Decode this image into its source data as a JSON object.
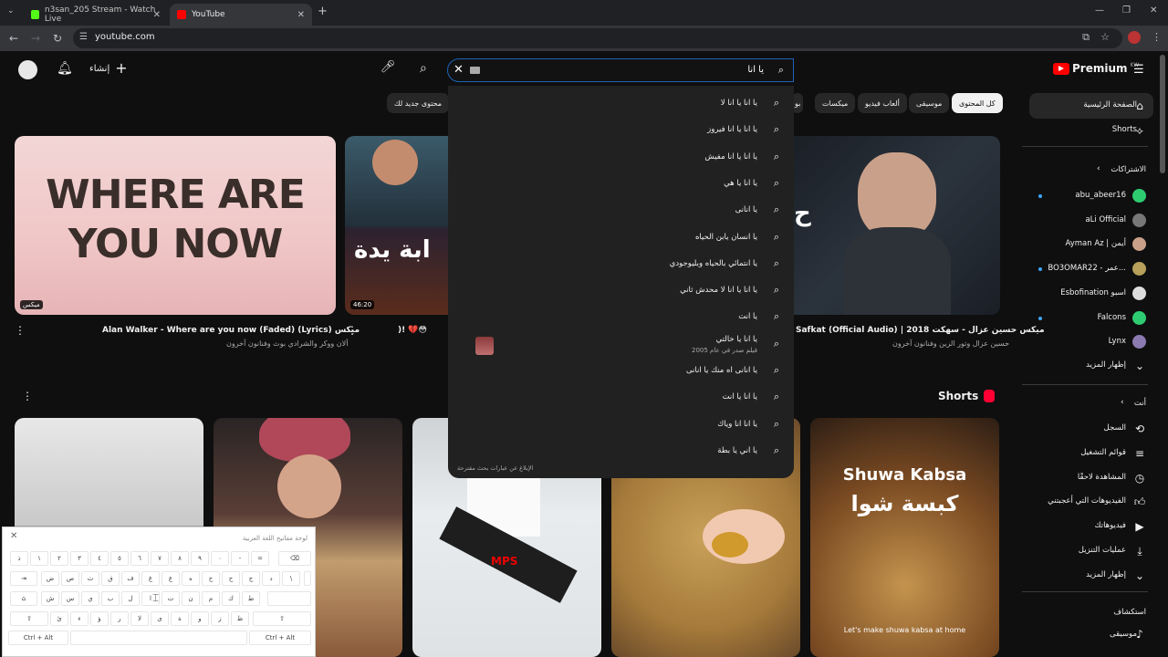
{
  "browser": {
    "tabs": [
      {
        "label": "n3san_205 Stream - Watch Live",
        "active": false
      },
      {
        "label": "YouTube",
        "active": true
      }
    ],
    "url": "youtube.com"
  },
  "header": {
    "create_label": "إنشاء",
    "search_query": "يا انا",
    "logo_text": "Premium",
    "logo_country": "KW"
  },
  "search_suggestions": [
    "يا انا يا انا لا",
    "يا انا يا انا فيروز",
    "يا انا يا انا مفيش",
    "يا انا يا هي",
    "يا انانى",
    "يا انسان يابن الحياه",
    "يا انتمائي بالحياه وبليوجودي",
    "يا انا يا انا لا محدش ثاني",
    "يا انت",
    "يا انا يا خالتي",
    "يا انانى اه منك يا انانى",
    "يا انا يا انت",
    "يا انا انا وياك",
    "يا اني يا بطة"
  ],
  "suggestion_movie_sub": "فيلم صدر في عام 2005",
  "suggest_report": "الإبلاغ عن عبارات بحث مقترحة",
  "chips": [
    "كل المحتوى",
    "موسيقى",
    "ألعاب فيديو",
    "ميكسات",
    "محتوى جديد لك"
  ],
  "chip_partial": "بو",
  "sidebar": {
    "home": "الصفحة الرئيسية",
    "shorts": "Shorts",
    "subs_title": "الاشتراكات",
    "subs": [
      "abu_abeer16",
      "aLi Official",
      "Ayman Az | أيمن",
      "BO3OMAR22 - عمر...",
      "Esbofination اسبو",
      "Falcons",
      "Lynx"
    ],
    "show_more": "إظهار المزيد",
    "you_title": "أنت",
    "you_items": [
      "السجل",
      "قوائم التشغيل",
      "المشاهدة لاحقًا",
      "الفيديوهات التي أعجبتني",
      "فيديوهاتك",
      "عمليات التنزيل",
      "إظهار المزيد"
    ],
    "explore_title": "استكشاف",
    "explore_items": [
      "موسيقى"
    ]
  },
  "videos": {
    "v1_title": "ميكس Alan Walker - Where are you now (Faded) (Lyrics)",
    "v1_sub": "ألان ووكر والشرادي بوث وفنانون آخرون",
    "v1_thumb_text": "WHERE ARE YOU NOW",
    "v1_badge": "ميكس",
    "v2_time": "46:20",
    "v2_title": "😳💔 !(",
    "v2_thumb_text": "ابة يدة",
    "v3_title": "ميكس حسين عزال - سهكت 2018 | Safkat (Official Audio)",
    "v3_sub": "حسين عزال وتور الزين وفنانون آخرون",
    "shorts_title": "Shorts",
    "short5_text1": "Shuwa Kabsa",
    "short5_text2": "كبسة شوا",
    "short5_caption": "Let's make shuwa kabsa at home"
  },
  "keyboard": {
    "title": "لوحة مفاتيح اللغة العربية",
    "row1": [
      "ذ",
      "١",
      "٢",
      "٣",
      "٤",
      "٥",
      "٦",
      "٧",
      "٨",
      "٩",
      "٠",
      "-",
      "="
    ],
    "row2": [
      "ض",
      "ص",
      "ث",
      "ق",
      "ف",
      "غ",
      "ع",
      "ه",
      "خ",
      "ح",
      "ج",
      "د",
      "\\"
    ],
    "row3": [
      "ش",
      "س",
      "ي",
      "ب",
      "ل",
      "ا",
      "ت",
      "ن",
      "م",
      "ك",
      "ط"
    ],
    "row4": [
      "ئ",
      "ء",
      "ؤ",
      "ر",
      "لا",
      "ى",
      "ة",
      "و",
      "ز",
      "ظ"
    ],
    "ctrl_alt": "Ctrl + Alt"
  },
  "colors": {
    "yt_red": "#ff0000",
    "bg": "#0f0f0f",
    "accent_blue": "#3ea6ff"
  }
}
